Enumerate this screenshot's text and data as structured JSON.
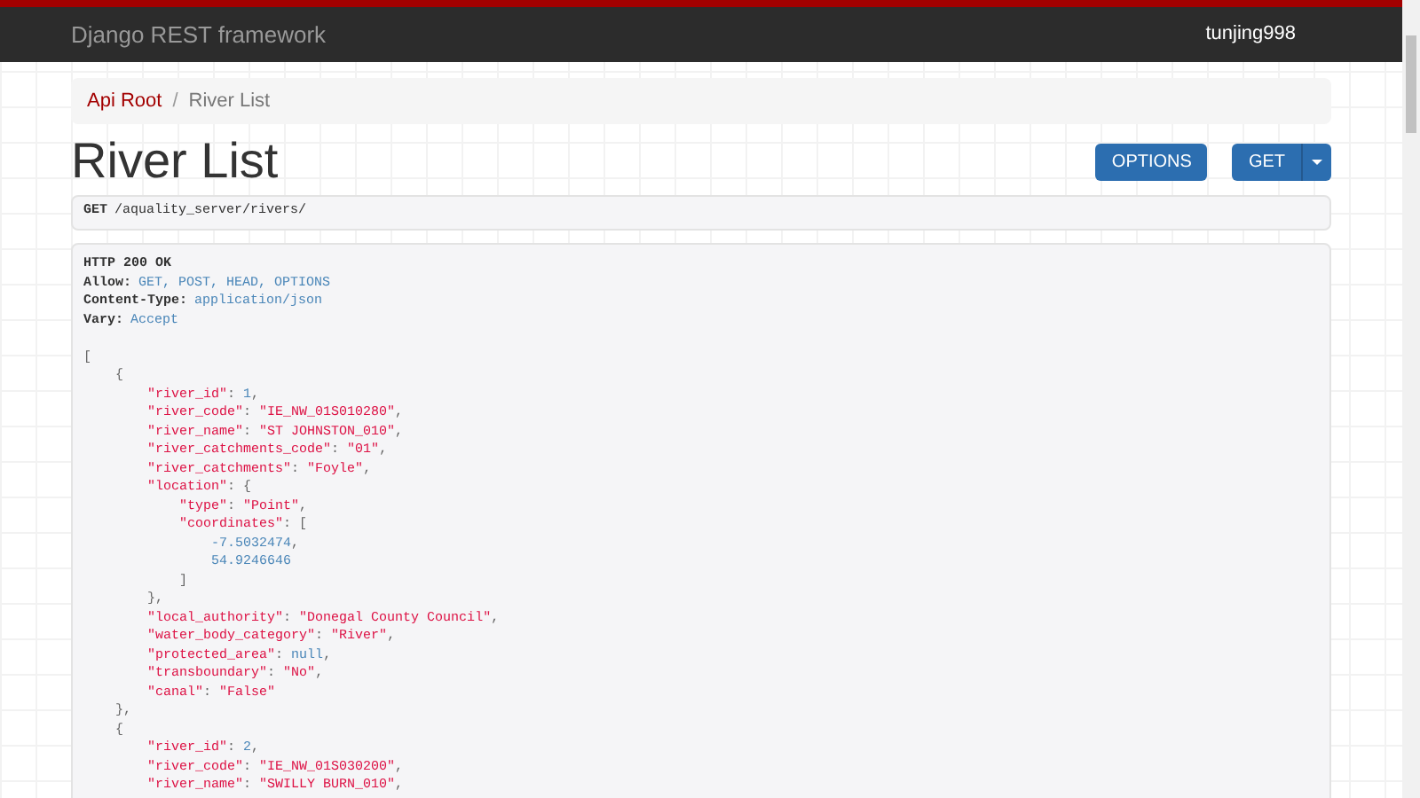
{
  "navbar": {
    "brand": "Django REST framework",
    "user": "tunjing998"
  },
  "breadcrumb": {
    "separator": "/",
    "items": [
      {
        "label": "Api Root",
        "selected": false
      },
      {
        "label": "River List",
        "selected": true
      }
    ]
  },
  "title": "River List",
  "buttons": {
    "options": "OPTIONS",
    "get": "GET"
  },
  "request": {
    "method": "GET",
    "path": "/aquality_server/rivers/"
  },
  "response": {
    "status": "HTTP 200 OK",
    "headers": [
      {
        "name": "Allow:",
        "value": "GET, POST, HEAD, OPTIONS"
      },
      {
        "name": "Content-Type:",
        "value": "application/json"
      },
      {
        "name": "Vary:",
        "value": "Accept"
      }
    ],
    "body": [
      [
        {
          "kind": "p",
          "text": "["
        }
      ],
      [
        {
          "kind": "p",
          "text": "    {"
        }
      ],
      [
        {
          "kind": "k",
          "text": "        \"river_id\""
        },
        {
          "kind": "p",
          "text": ": "
        },
        {
          "kind": "n",
          "text": "1"
        },
        {
          "kind": "p",
          "text": ","
        }
      ],
      [
        {
          "kind": "k",
          "text": "        \"river_code\""
        },
        {
          "kind": "p",
          "text": ": "
        },
        {
          "kind": "s",
          "text": "\"IE_NW_01S010280\""
        },
        {
          "kind": "p",
          "text": ","
        }
      ],
      [
        {
          "kind": "k",
          "text": "        \"river_name\""
        },
        {
          "kind": "p",
          "text": ": "
        },
        {
          "kind": "s",
          "text": "\"ST JOHNSTON_010\""
        },
        {
          "kind": "p",
          "text": ","
        }
      ],
      [
        {
          "kind": "k",
          "text": "        \"river_catchments_code\""
        },
        {
          "kind": "p",
          "text": ": "
        },
        {
          "kind": "s",
          "text": "\"01\""
        },
        {
          "kind": "p",
          "text": ","
        }
      ],
      [
        {
          "kind": "k",
          "text": "        \"river_catchments\""
        },
        {
          "kind": "p",
          "text": ": "
        },
        {
          "kind": "s",
          "text": "\"Foyle\""
        },
        {
          "kind": "p",
          "text": ","
        }
      ],
      [
        {
          "kind": "k",
          "text": "        \"location\""
        },
        {
          "kind": "p",
          "text": ": {"
        }
      ],
      [
        {
          "kind": "k",
          "text": "            \"type\""
        },
        {
          "kind": "p",
          "text": ": "
        },
        {
          "kind": "s",
          "text": "\"Point\""
        },
        {
          "kind": "p",
          "text": ","
        }
      ],
      [
        {
          "kind": "k",
          "text": "            \"coordinates\""
        },
        {
          "kind": "p",
          "text": ": ["
        }
      ],
      [
        {
          "kind": "n",
          "text": "                -7.5032474"
        },
        {
          "kind": "p",
          "text": ","
        }
      ],
      [
        {
          "kind": "n",
          "text": "                54.9246646"
        }
      ],
      [
        {
          "kind": "p",
          "text": "            ]"
        }
      ],
      [
        {
          "kind": "p",
          "text": "        },"
        }
      ],
      [
        {
          "kind": "k",
          "text": "        \"local_authority\""
        },
        {
          "kind": "p",
          "text": ": "
        },
        {
          "kind": "s",
          "text": "\"Donegal County Council\""
        },
        {
          "kind": "p",
          "text": ","
        }
      ],
      [
        {
          "kind": "k",
          "text": "        \"water_body_category\""
        },
        {
          "kind": "p",
          "text": ": "
        },
        {
          "kind": "s",
          "text": "\"River\""
        },
        {
          "kind": "p",
          "text": ","
        }
      ],
      [
        {
          "kind": "k",
          "text": "        \"protected_area\""
        },
        {
          "kind": "p",
          "text": ": "
        },
        {
          "kind": "n",
          "text": "null"
        },
        {
          "kind": "p",
          "text": ","
        }
      ],
      [
        {
          "kind": "k",
          "text": "        \"transboundary\""
        },
        {
          "kind": "p",
          "text": ": "
        },
        {
          "kind": "s",
          "text": "\"No\""
        },
        {
          "kind": "p",
          "text": ","
        }
      ],
      [
        {
          "kind": "k",
          "text": "        \"canal\""
        },
        {
          "kind": "p",
          "text": ": "
        },
        {
          "kind": "s",
          "text": "\"False\""
        }
      ],
      [
        {
          "kind": "p",
          "text": "    },"
        }
      ],
      [
        {
          "kind": "p",
          "text": "    {"
        }
      ],
      [
        {
          "kind": "k",
          "text": "        \"river_id\""
        },
        {
          "kind": "p",
          "text": ": "
        },
        {
          "kind": "n",
          "text": "2"
        },
        {
          "kind": "p",
          "text": ","
        }
      ],
      [
        {
          "kind": "k",
          "text": "        \"river_code\""
        },
        {
          "kind": "p",
          "text": ": "
        },
        {
          "kind": "s",
          "text": "\"IE_NW_01S030200\""
        },
        {
          "kind": "p",
          "text": ","
        }
      ],
      [
        {
          "kind": "k",
          "text": "        \"river_name\""
        },
        {
          "kind": "p",
          "text": ": "
        },
        {
          "kind": "s",
          "text": "\"SWILLY BURN_010\""
        },
        {
          "kind": "p",
          "text": ","
        }
      ]
    ]
  }
}
